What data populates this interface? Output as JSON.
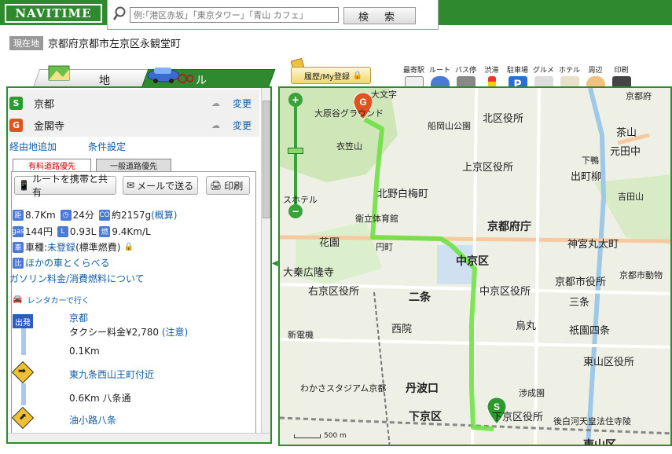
{
  "header": {
    "logo": "NAVITIME",
    "search_placeholder": "例:｢港区赤坂｣「東京タワー」「青山 カフェ」",
    "search_button": "検 索"
  },
  "location": {
    "tag": "現在地",
    "address": "京都府京都市左京区永観堂町"
  },
  "tabs": {
    "map": "地 図",
    "route": "ルート"
  },
  "toolbar": {
    "history": "履歴/My登録",
    "items": [
      "最寄駅",
      "ルート",
      "バス停",
      "渋滞",
      "駐車場",
      "グルメ",
      "ホテル",
      "周辺",
      "印刷"
    ]
  },
  "route_panel": {
    "start": {
      "badge": "S",
      "name": "京都",
      "change": "変更"
    },
    "goal": {
      "badge": "G",
      "name": "金閣寺",
      "change": "変更"
    },
    "add_waypoint": "経由地追加",
    "conditions": "条件設定",
    "subtabs": [
      "有料道路優先",
      "一般道路優先"
    ],
    "share_button": "ルートを携帯と共有",
    "mail_button": "メールで送る",
    "print_button": "印刷",
    "stats": {
      "distance": "8.7Km",
      "time": "24分",
      "co2_prefix": "約2157g",
      "co2_link": "(概算)",
      "gas": "144円",
      "fuel": "0.93L",
      "efficiency": "9.4Km/L",
      "vehicle_label": "車種:",
      "vehicle_link": "未登録",
      "vehicle_note": "(標準燃費)",
      "compare_link": "ほかの車とくらべる",
      "gas_link": "ガソリン料金/消費燃料について"
    },
    "rental": "レンタカーで行く",
    "steps": [
      {
        "kind": "depart",
        "icon_label": "出発",
        "name": "京都",
        "detail": "タクシー料金¥2,780",
        "detail_link": "(注意)"
      },
      {
        "kind": "distance",
        "text": "0.1Km"
      },
      {
        "kind": "turn",
        "name": "東九条西山王町付近"
      },
      {
        "kind": "distance",
        "text": "0.6Km 八条通"
      },
      {
        "kind": "turn",
        "name": "油小路八条"
      }
    ]
  },
  "map": {
    "scale": "500 m",
    "labels": [
      "大原谷グラウンド",
      "衣笠山",
      "船岡山公園",
      "北区役所",
      "上京区役所",
      "北野白梅町",
      "京都府庁",
      "衛立体育館",
      "花園",
      "円町",
      "中京区",
      "大秦広隆寺",
      "右京区役所",
      "二条",
      "中京区役所",
      "京都市役所",
      "神宮丸太町",
      "出町柳",
      "茶山",
      "元田中",
      "吉田山",
      "三条",
      "烏丸",
      "祇園四条",
      "西院",
      "丹波口",
      "わかさスタジアム京都",
      "下京区",
      "下京区役所",
      "東山区役所",
      "東山区",
      "後白河天皇法住寺陵",
      "新電機",
      "渉成園",
      "京都府",
      "大文字",
      "京都市動物",
      "スホテル",
      "下鴨"
    ]
  },
  "colors": {
    "brand": "#2f8a2f",
    "route": "#66e03a",
    "link": "#115ea8",
    "start": "#2d9a2d",
    "goal": "#e0531f"
  }
}
